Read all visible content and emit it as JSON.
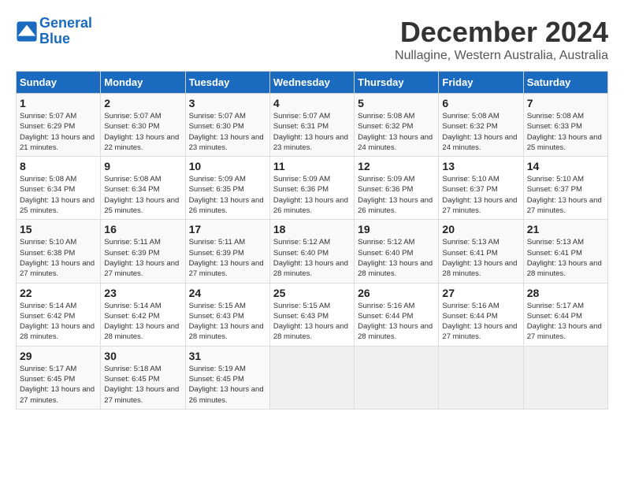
{
  "logo": {
    "line1": "General",
    "line2": "Blue"
  },
  "title": "December 2024",
  "subtitle": "Nullagine, Western Australia, Australia",
  "days_of_week": [
    "Sunday",
    "Monday",
    "Tuesday",
    "Wednesday",
    "Thursday",
    "Friday",
    "Saturday"
  ],
  "weeks": [
    [
      {
        "day": "1",
        "sunrise": "Sunrise: 5:07 AM",
        "sunset": "Sunset: 6:29 PM",
        "daylight": "Daylight: 13 hours and 21 minutes."
      },
      {
        "day": "2",
        "sunrise": "Sunrise: 5:07 AM",
        "sunset": "Sunset: 6:30 PM",
        "daylight": "Daylight: 13 hours and 22 minutes."
      },
      {
        "day": "3",
        "sunrise": "Sunrise: 5:07 AM",
        "sunset": "Sunset: 6:30 PM",
        "daylight": "Daylight: 13 hours and 23 minutes."
      },
      {
        "day": "4",
        "sunrise": "Sunrise: 5:07 AM",
        "sunset": "Sunset: 6:31 PM",
        "daylight": "Daylight: 13 hours and 23 minutes."
      },
      {
        "day": "5",
        "sunrise": "Sunrise: 5:08 AM",
        "sunset": "Sunset: 6:32 PM",
        "daylight": "Daylight: 13 hours and 24 minutes."
      },
      {
        "day": "6",
        "sunrise": "Sunrise: 5:08 AM",
        "sunset": "Sunset: 6:32 PM",
        "daylight": "Daylight: 13 hours and 24 minutes."
      },
      {
        "day": "7",
        "sunrise": "Sunrise: 5:08 AM",
        "sunset": "Sunset: 6:33 PM",
        "daylight": "Daylight: 13 hours and 25 minutes."
      }
    ],
    [
      {
        "day": "8",
        "sunrise": "Sunrise: 5:08 AM",
        "sunset": "Sunset: 6:34 PM",
        "daylight": "Daylight: 13 hours and 25 minutes."
      },
      {
        "day": "9",
        "sunrise": "Sunrise: 5:08 AM",
        "sunset": "Sunset: 6:34 PM",
        "daylight": "Daylight: 13 hours and 25 minutes."
      },
      {
        "day": "10",
        "sunrise": "Sunrise: 5:09 AM",
        "sunset": "Sunset: 6:35 PM",
        "daylight": "Daylight: 13 hours and 26 minutes."
      },
      {
        "day": "11",
        "sunrise": "Sunrise: 5:09 AM",
        "sunset": "Sunset: 6:36 PM",
        "daylight": "Daylight: 13 hours and 26 minutes."
      },
      {
        "day": "12",
        "sunrise": "Sunrise: 5:09 AM",
        "sunset": "Sunset: 6:36 PM",
        "daylight": "Daylight: 13 hours and 26 minutes."
      },
      {
        "day": "13",
        "sunrise": "Sunrise: 5:10 AM",
        "sunset": "Sunset: 6:37 PM",
        "daylight": "Daylight: 13 hours and 27 minutes."
      },
      {
        "day": "14",
        "sunrise": "Sunrise: 5:10 AM",
        "sunset": "Sunset: 6:37 PM",
        "daylight": "Daylight: 13 hours and 27 minutes."
      }
    ],
    [
      {
        "day": "15",
        "sunrise": "Sunrise: 5:10 AM",
        "sunset": "Sunset: 6:38 PM",
        "daylight": "Daylight: 13 hours and 27 minutes."
      },
      {
        "day": "16",
        "sunrise": "Sunrise: 5:11 AM",
        "sunset": "Sunset: 6:39 PM",
        "daylight": "Daylight: 13 hours and 27 minutes."
      },
      {
        "day": "17",
        "sunrise": "Sunrise: 5:11 AM",
        "sunset": "Sunset: 6:39 PM",
        "daylight": "Daylight: 13 hours and 27 minutes."
      },
      {
        "day": "18",
        "sunrise": "Sunrise: 5:12 AM",
        "sunset": "Sunset: 6:40 PM",
        "daylight": "Daylight: 13 hours and 28 minutes."
      },
      {
        "day": "19",
        "sunrise": "Sunrise: 5:12 AM",
        "sunset": "Sunset: 6:40 PM",
        "daylight": "Daylight: 13 hours and 28 minutes."
      },
      {
        "day": "20",
        "sunrise": "Sunrise: 5:13 AM",
        "sunset": "Sunset: 6:41 PM",
        "daylight": "Daylight: 13 hours and 28 minutes."
      },
      {
        "day": "21",
        "sunrise": "Sunrise: 5:13 AM",
        "sunset": "Sunset: 6:41 PM",
        "daylight": "Daylight: 13 hours and 28 minutes."
      }
    ],
    [
      {
        "day": "22",
        "sunrise": "Sunrise: 5:14 AM",
        "sunset": "Sunset: 6:42 PM",
        "daylight": "Daylight: 13 hours and 28 minutes."
      },
      {
        "day": "23",
        "sunrise": "Sunrise: 5:14 AM",
        "sunset": "Sunset: 6:42 PM",
        "daylight": "Daylight: 13 hours and 28 minutes."
      },
      {
        "day": "24",
        "sunrise": "Sunrise: 5:15 AM",
        "sunset": "Sunset: 6:43 PM",
        "daylight": "Daylight: 13 hours and 28 minutes."
      },
      {
        "day": "25",
        "sunrise": "Sunrise: 5:15 AM",
        "sunset": "Sunset: 6:43 PM",
        "daylight": "Daylight: 13 hours and 28 minutes."
      },
      {
        "day": "26",
        "sunrise": "Sunrise: 5:16 AM",
        "sunset": "Sunset: 6:44 PM",
        "daylight": "Daylight: 13 hours and 28 minutes."
      },
      {
        "day": "27",
        "sunrise": "Sunrise: 5:16 AM",
        "sunset": "Sunset: 6:44 PM",
        "daylight": "Daylight: 13 hours and 27 minutes."
      },
      {
        "day": "28",
        "sunrise": "Sunrise: 5:17 AM",
        "sunset": "Sunset: 6:44 PM",
        "daylight": "Daylight: 13 hours and 27 minutes."
      }
    ],
    [
      {
        "day": "29",
        "sunrise": "Sunrise: 5:17 AM",
        "sunset": "Sunset: 6:45 PM",
        "daylight": "Daylight: 13 hours and 27 minutes."
      },
      {
        "day": "30",
        "sunrise": "Sunrise: 5:18 AM",
        "sunset": "Sunset: 6:45 PM",
        "daylight": "Daylight: 13 hours and 27 minutes."
      },
      {
        "day": "31",
        "sunrise": "Sunrise: 5:19 AM",
        "sunset": "Sunset: 6:45 PM",
        "daylight": "Daylight: 13 hours and 26 minutes."
      },
      null,
      null,
      null,
      null
    ]
  ]
}
